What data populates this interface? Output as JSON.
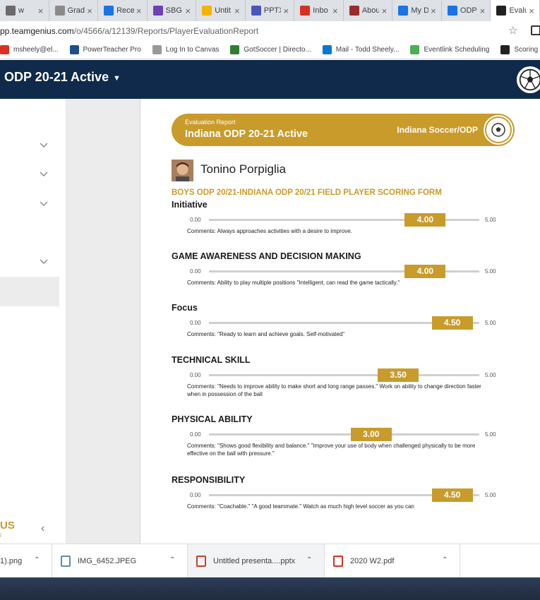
{
  "browser": {
    "tabs": [
      {
        "label": "w",
        "color": "#6b6b6b"
      },
      {
        "label": "Grad",
        "color": "#8a8a8a"
      },
      {
        "label": "Rece",
        "color": "#1a73e8"
      },
      {
        "label": "SBG",
        "color": "#6f3fb6"
      },
      {
        "label": "Untit",
        "color": "#f4b400"
      },
      {
        "label": "PPTX",
        "color": "#4b53bc"
      },
      {
        "label": "Inbo",
        "color": "#d93025"
      },
      {
        "label": "Abou",
        "color": "#9c2b2b"
      },
      {
        "label": "My D",
        "color": "#1a73e8"
      },
      {
        "label": "ODP",
        "color": "#1a73e8"
      },
      {
        "label": "Evalu",
        "color": "#222222"
      }
    ],
    "close_glyph": "×",
    "url_main": "pp.teamgenius.com",
    "url_path": "/o/4566/a/12139/Reports/PlayerEvaluationReport",
    "bookmarks": [
      {
        "label": "msheely@el...",
        "color": "#d93025"
      },
      {
        "label": "PowerTeacher Pro",
        "color": "#1c4f8c"
      },
      {
        "label": "Log In to Canvas",
        "color": "#999999"
      },
      {
        "label": "GotSoccer | Directo...",
        "color": "#2e7d32"
      },
      {
        "label": "Mail - Todd Sheely...",
        "color": "#0078d4"
      },
      {
        "label": "Eventlink Scheduling",
        "color": "#4caf50"
      },
      {
        "label": "Scoring Forms - T",
        "color": "#222222"
      }
    ]
  },
  "app": {
    "title": "ODP 20-21 Active",
    "sidebar_logo": "US"
  },
  "report": {
    "banner_sub": "Evaluation Report",
    "banner_title": "Indiana ODP 20-21 Active",
    "organization": "Indiana Soccer/ODP",
    "player_name": "Tonino Porpiglia",
    "form_title": "BOYS ODP 20/21-INDIANA ODP 20/21 FIELD PLAYER SCORING FORM",
    "scale_min_label": "0.00",
    "scale_max_label": "5.00",
    "scale_min": 0,
    "scale_max": 5,
    "criteria": [
      {
        "name": "Initiative",
        "score_label": "4.00",
        "score": 4.0,
        "comment": "Comments: Always approaches activities with a desire to improve."
      },
      {
        "name": "GAME AWARENESS AND DECISION MAKING",
        "score_label": "4.00",
        "score": 4.0,
        "comment": "Comments: Ability to play multiple positions \"Intelligent, can read the game tactically.\""
      },
      {
        "name": "Focus",
        "score_label": "4.50",
        "score": 4.5,
        "comment": "Comments: \"Ready to learn and achieve goals. Self-motivated\""
      },
      {
        "name": "TECHNICAL SKILL",
        "score_label": "3.50",
        "score": 3.5,
        "comment": "Comments: \"Needs to improve ability to make short and long range passes.\" Work on ability to change direction faster when in possession of the ball"
      },
      {
        "name": "PHYSICAL ABILITY",
        "score_label": "3.00",
        "score": 3.0,
        "comment": "Comments: \"Shows good flexibility and balance.\" \"Improve your use of body when challenged physically to be more effective on the ball with pressure.\""
      },
      {
        "name": "RESPONSIBILITY",
        "score_label": "4.50",
        "score": 4.5,
        "comment": "Comments: \"Coachable.\" \"A good teammate.\" Watch as much high level soccer as you can"
      }
    ]
  },
  "downloads": [
    {
      "label": "1).png",
      "icon": "image-file-icon"
    },
    {
      "label": "IMG_6452.JPEG",
      "icon": "image-file-icon"
    },
    {
      "label": "Untitled presenta....pptx",
      "icon": "pptx-file-icon"
    },
    {
      "label": "2020 W2.pdf",
      "icon": "pdf-file-icon"
    }
  ],
  "colors": {
    "accent_gold": "#c89b2b",
    "header_navy": "#0f2a4a"
  }
}
